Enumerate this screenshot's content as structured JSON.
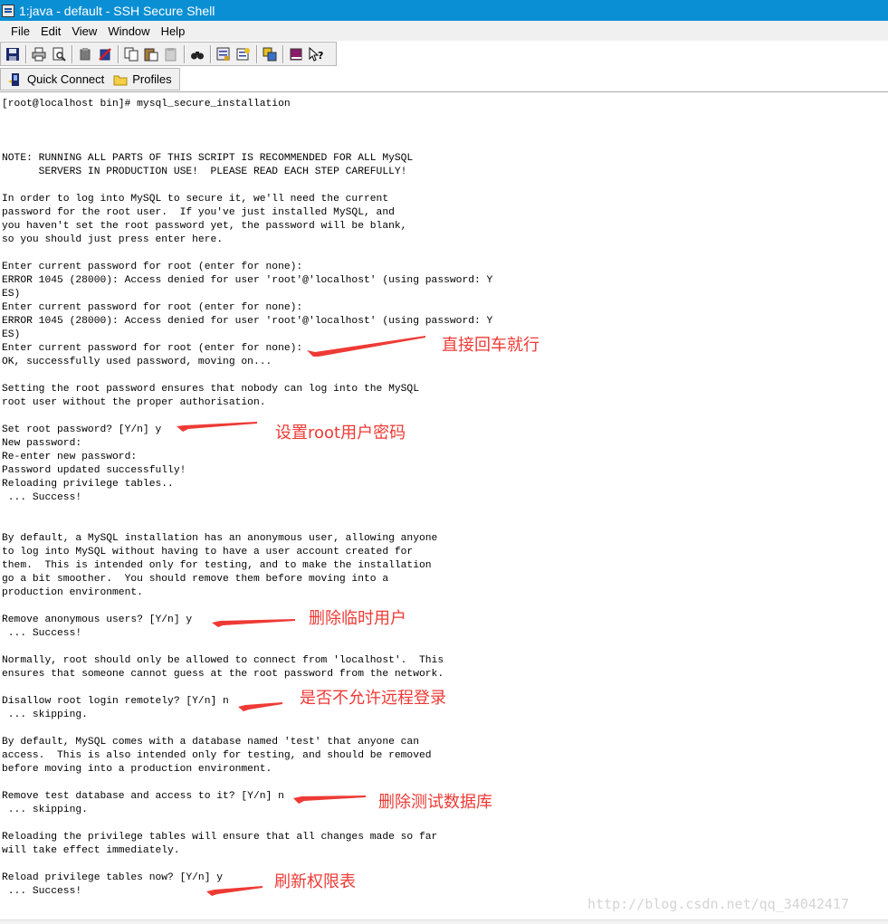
{
  "window": {
    "title": "1:java - default - SSH Secure Shell"
  },
  "menu": [
    "File",
    "Edit",
    "View",
    "Window",
    "Help"
  ],
  "toolbar": {
    "icons": [
      "save-icon",
      "print-icon",
      "print-preview-icon",
      "disconnect-icon",
      "reconnect-icon",
      "copy-icon",
      "paste-icon",
      "paste-disabled-icon",
      "find-icon",
      "settings-icon",
      "profile-settings-icon",
      "file-transfer-icon",
      "help-book-icon",
      "context-help-icon"
    ]
  },
  "quickbar": {
    "quick_connect": "Quick Connect",
    "profiles": "Profiles"
  },
  "terminal": {
    "lines": [
      "[root@localhost bin]# mysql_secure_installation",
      "",
      "",
      "",
      "NOTE: RUNNING ALL PARTS OF THIS SCRIPT IS RECOMMENDED FOR ALL MySQL",
      "      SERVERS IN PRODUCTION USE!  PLEASE READ EACH STEP CAREFULLY!",
      "",
      "In order to log into MySQL to secure it, we'll need the current",
      "password for the root user.  If you've just installed MySQL, and",
      "you haven't set the root password yet, the password will be blank,",
      "so you should just press enter here.",
      "",
      "Enter current password for root (enter for none):",
      "ERROR 1045 (28000): Access denied for user 'root'@'localhost' (using password: Y",
      "ES)",
      "Enter current password for root (enter for none):",
      "ERROR 1045 (28000): Access denied for user 'root'@'localhost' (using password: Y",
      "ES)",
      "Enter current password for root (enter for none):",
      "OK, successfully used password, moving on...",
      "",
      "Setting the root password ensures that nobody can log into the MySQL",
      "root user without the proper authorisation.",
      "",
      "Set root password? [Y/n] y",
      "New password:",
      "Re-enter new password:",
      "Password updated successfully!",
      "Reloading privilege tables..",
      " ... Success!",
      "",
      "",
      "By default, a MySQL installation has an anonymous user, allowing anyone",
      "to log into MySQL without having to have a user account created for",
      "them.  This is intended only for testing, and to make the installation",
      "go a bit smoother.  You should remove them before moving into a",
      "production environment.",
      "",
      "Remove anonymous users? [Y/n] y",
      " ... Success!",
      "",
      "Normally, root should only be allowed to connect from 'localhost'.  This",
      "ensures that someone cannot guess at the root password from the network.",
      "",
      "Disallow root login remotely? [Y/n] n",
      " ... skipping.",
      "",
      "By default, MySQL comes with a database named 'test' that anyone can",
      "access.  This is also intended only for testing, and should be removed",
      "before moving into a production environment.",
      "",
      "Remove test database and access to it? [Y/n] n",
      " ... skipping.",
      "",
      "Reloading the privilege tables will ensure that all changes made so far",
      "will take effect immediately.",
      "",
      "Reload privilege tables now? [Y/n] y",
      " ... Success!"
    ]
  },
  "annotations": [
    {
      "text": "直接回车就行"
    },
    {
      "text": "设置root用户密码"
    },
    {
      "text": "删除临时用户"
    },
    {
      "text": "是否不允许远程登录"
    },
    {
      "text": "删除测试数据库"
    },
    {
      "text": "刷新权限表"
    }
  ],
  "annotation_color": "#ee3a35",
  "watermark": "http://blog.csdn.net/qq_34042417"
}
